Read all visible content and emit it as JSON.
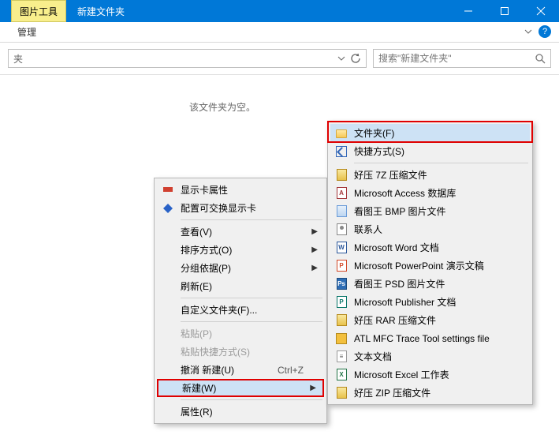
{
  "titlebar": {
    "image_tools": "图片工具",
    "window_title": "新建文件夹"
  },
  "ribbon": {
    "manage": "管理"
  },
  "address": {
    "text": "夹"
  },
  "search": {
    "placeholder": "搜索\"新建文件夹\""
  },
  "content": {
    "empty": "该文件夹为空。"
  },
  "context_menu": {
    "display_props": "显示卡属性",
    "switchable_gfx": "配置可交换显示卡",
    "view": "查看(V)",
    "sort": "排序方式(O)",
    "group": "分组依据(P)",
    "refresh": "刷新(E)",
    "customize": "自定义文件夹(F)...",
    "paste": "粘贴(P)",
    "paste_shortcut": "粘贴快捷方式(S)",
    "undo": "撤消 新建(U)",
    "undo_kbd": "Ctrl+Z",
    "new": "新建(W)",
    "properties": "属性(R)"
  },
  "new_submenu": {
    "folder": "文件夹(F)",
    "shortcut": "快捷方式(S)",
    "haozip7z": "好压 7Z 压缩文件",
    "access": "Microsoft Access 数据库",
    "bmp": "看图王 BMP 图片文件",
    "contact": "联系人",
    "word": "Microsoft Word 文档",
    "ppt": "Microsoft PowerPoint 演示文稿",
    "psd": "看图王 PSD 图片文件",
    "publisher": "Microsoft Publisher 文档",
    "haozip_rar": "好压 RAR 压缩文件",
    "atl": "ATL MFC Trace Tool settings file",
    "txt": "文本文档",
    "excel": "Microsoft Excel 工作表",
    "haozip_zip": "好压 ZIP 压缩文件"
  }
}
